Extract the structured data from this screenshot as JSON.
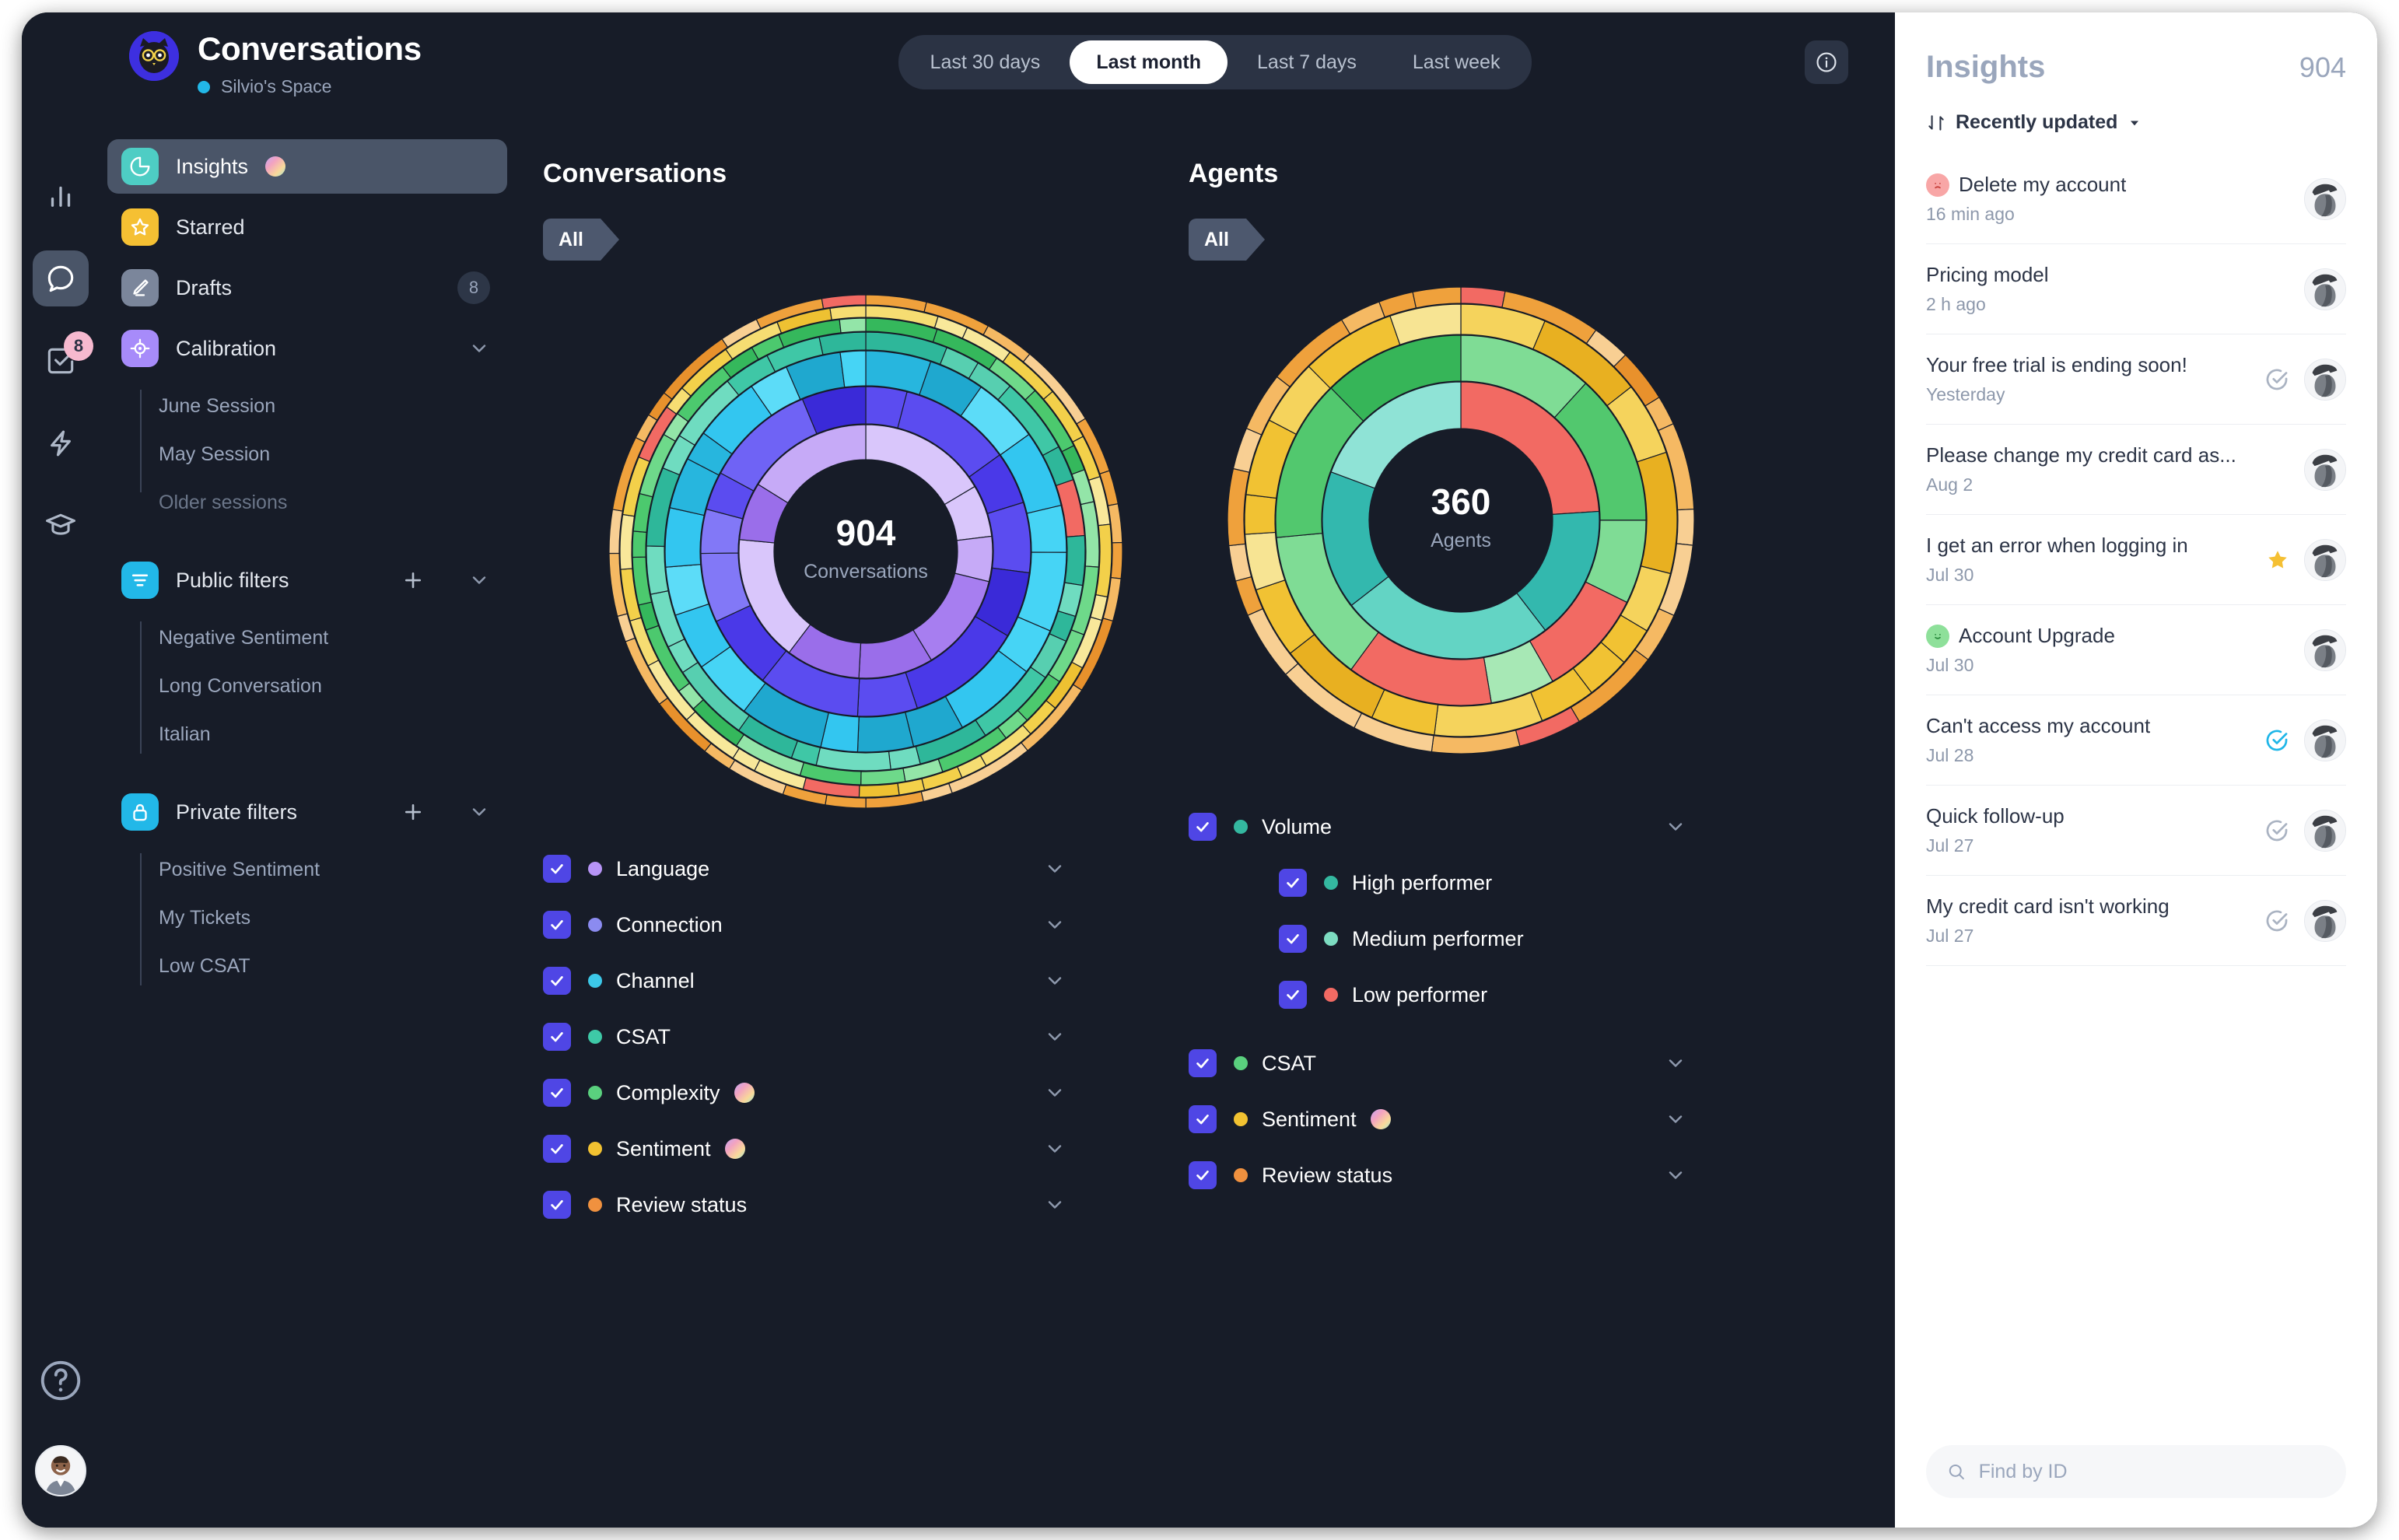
{
  "colors": {
    "window_bg": "#171c28",
    "panel_bg": "#ffffff",
    "accent_blue": "#22b8e8",
    "checkbox": "#4f46e5",
    "badge_pink": "#f6b9cf",
    "star_yellow": "#f5c033"
  },
  "rail": {
    "items": [
      {
        "icon": "bar-chart-icon",
        "active": false,
        "badge": ""
      },
      {
        "icon": "chat-bubble-icon",
        "active": true,
        "badge": ""
      },
      {
        "icon": "tasks-checkbox-icon",
        "active": false,
        "badge": "8"
      },
      {
        "icon": "lightning-bolt-icon",
        "active": false,
        "badge": ""
      },
      {
        "icon": "graduation-cap-icon",
        "active": false,
        "badge": ""
      }
    ],
    "help_icon": "help-circle-icon"
  },
  "sidebar": {
    "page_title": "Conversations",
    "space_name": "Silvio's Space",
    "nav": [
      {
        "label": "Insights",
        "icon": "pie-chart-icon",
        "icon_bg": "#4ecdc4",
        "selected": true,
        "gradient_dot": true,
        "count": "",
        "chevron": false
      },
      {
        "label": "Starred",
        "icon": "star-icon",
        "icon_bg": "#f5c033",
        "selected": false,
        "gradient_dot": false,
        "count": "",
        "chevron": false
      },
      {
        "label": "Drafts",
        "icon": "pencil-icon",
        "icon_bg": "#7b869b",
        "selected": false,
        "gradient_dot": false,
        "count": "8",
        "chevron": false
      },
      {
        "label": "Calibration",
        "icon": "target-icon",
        "icon_bg": "#a78bfa",
        "selected": false,
        "gradient_dot": false,
        "count": "",
        "chevron": true
      }
    ],
    "calibration_sessions": [
      "June Session",
      "May Session",
      "Older sessions"
    ],
    "public_filters": {
      "label": "Public filters",
      "icon": "filter-lines-icon",
      "icon_bg": "#22b8e8",
      "items": [
        "Negative Sentiment",
        "Long Conversation",
        "Italian"
      ]
    },
    "private_filters": {
      "label": "Private filters",
      "icon": "lock-icon",
      "icon_bg": "#22b8e8",
      "items": [
        "Positive Sentiment",
        "My Tickets",
        "Low CSAT"
      ]
    }
  },
  "topbar": {
    "ranges": [
      "Last 30 days",
      "Last month",
      "Last 7 days",
      "Last week"
    ],
    "active_range": "Last month",
    "info_icon": "info-circle-icon"
  },
  "chart_data": [
    {
      "type": "pie",
      "title": "Conversations",
      "breadcrumb_chip": "All",
      "center_value": "904",
      "center_label": "Conversations",
      "rings": [
        "Language",
        "Connection",
        "Channel",
        "CSAT",
        "Complexity",
        "Sentiment",
        "Review status"
      ],
      "legend": [
        {
          "label": "Language",
          "color": "#b794f6",
          "checked": true,
          "gradient": false
        },
        {
          "label": "Connection",
          "color": "#8b8bf0",
          "checked": true,
          "gradient": false
        },
        {
          "label": "Channel",
          "color": "#3cc8e8",
          "checked": true,
          "gradient": false
        },
        {
          "label": "CSAT",
          "color": "#3ec9a7",
          "checked": true,
          "gradient": false
        },
        {
          "label": "Complexity",
          "color": "#5ad07e",
          "checked": true,
          "gradient": true
        },
        {
          "label": "Sentiment",
          "color": "#f2c231",
          "checked": true,
          "gradient": true
        },
        {
          "label": "Review status",
          "color": "#f0913f",
          "checked": true,
          "gradient": false
        }
      ]
    },
    {
      "type": "pie",
      "title": "Agents",
      "breadcrumb_chip": "All",
      "center_value": "360",
      "center_label": "Agents",
      "rings": [
        "Volume",
        "CSAT",
        "Sentiment",
        "Review status"
      ],
      "legend": [
        {
          "label": "Volume",
          "color": "#34b8a0",
          "checked": true,
          "gradient": false,
          "indent": false
        },
        {
          "label": "High performer",
          "color": "#34b8a0",
          "checked": true,
          "gradient": false,
          "indent": true
        },
        {
          "label": "Medium performer",
          "color": "#7ddcc1",
          "checked": true,
          "gradient": false,
          "indent": true
        },
        {
          "label": "Low performer",
          "color": "#f26a63",
          "checked": true,
          "gradient": false,
          "indent": true
        },
        {
          "label": "CSAT",
          "color": "#5ad07e",
          "checked": true,
          "gradient": false,
          "indent": false
        },
        {
          "label": "Sentiment",
          "color": "#f2c231",
          "checked": true,
          "gradient": true,
          "indent": false
        },
        {
          "label": "Review status",
          "color": "#f0913f",
          "checked": true,
          "gradient": false,
          "indent": false
        }
      ]
    }
  ],
  "insights": {
    "title": "Insights",
    "count": "904",
    "sort_label": "Recently updated",
    "sort_icon": "sort-arrows-icon",
    "search_placeholder": "Find by ID",
    "search_value": "",
    "search_icon": "search-icon",
    "items": [
      {
        "subject": "Delete my account",
        "date": "16 min ago",
        "mood": "sad",
        "check": "none",
        "star": false
      },
      {
        "subject": "Pricing model",
        "date": "2 h ago",
        "mood": "none",
        "check": "none",
        "star": false
      },
      {
        "subject": "Your free trial is ending soon!",
        "date": "Yesterday",
        "mood": "none",
        "check": "grey",
        "star": false
      },
      {
        "subject": "Please change my credit card as...",
        "date": "Aug 2",
        "mood": "none",
        "check": "none",
        "star": false
      },
      {
        "subject": "I get an error when logging in",
        "date": "Jul 30",
        "mood": "none",
        "check": "none",
        "star": true
      },
      {
        "subject": "Account Upgrade",
        "date": "Jul 30",
        "mood": "happy",
        "check": "none",
        "star": false
      },
      {
        "subject": "Can't access my account",
        "date": "Jul 28",
        "mood": "none",
        "check": "blue",
        "star": false
      },
      {
        "subject": "Quick follow-up",
        "date": "Jul 27",
        "mood": "none",
        "check": "grey",
        "star": false
      },
      {
        "subject": "My credit card isn't working",
        "date": "Jul 27",
        "mood": "none",
        "check": "grey",
        "star": false
      }
    ]
  }
}
